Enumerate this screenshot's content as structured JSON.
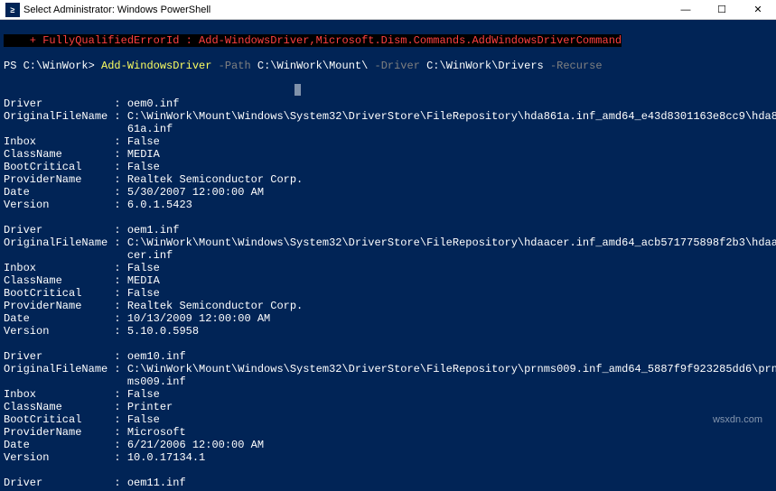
{
  "window": {
    "icon_text": "≥",
    "title": "Select Administrator: Windows PowerShell",
    "minimize": "—",
    "maximize": "☐",
    "close": "✕"
  },
  "error": {
    "line": "    + FullyQualifiedErrorId : Add-WindowsDriver,Microsoft.Dism.Commands.AddWindowsDriverCommand"
  },
  "command": {
    "prompt": "PS C:\\WinWork> ",
    "cmdlet": "Add-WindowsDriver ",
    "param1": "-Path ",
    "val1": "C:\\WinWork\\Mount\\ ",
    "param2": "-Driver ",
    "val2": "C:\\WinWork\\Drivers ",
    "param3": "-Recurse"
  },
  "drivers": [
    {
      "Driver": "oem0.inf",
      "OriginalFileName": "C:\\WinWork\\Mount\\Windows\\System32\\DriverStore\\FileRepository\\hda861a.inf_amd64_e43d8301163e8cc9\\hda8",
      "OriginalFileName2": "61a.inf",
      "Inbox": "False",
      "ClassName": "MEDIA",
      "BootCritical": "False",
      "ProviderName": "Realtek Semiconductor Corp.",
      "Date": "5/30/2007 12:00:00 AM",
      "Version": "6.0.1.5423"
    },
    {
      "Driver": "oem1.inf",
      "OriginalFileName": "C:\\WinWork\\Mount\\Windows\\System32\\DriverStore\\FileRepository\\hdaacer.inf_amd64_acb571775898f2b3\\hdaa",
      "OriginalFileName2": "cer.inf",
      "Inbox": "False",
      "ClassName": "MEDIA",
      "BootCritical": "False",
      "ProviderName": "Realtek Semiconductor Corp.",
      "Date": "10/13/2009 12:00:00 AM",
      "Version": "5.10.0.5958"
    },
    {
      "Driver": "oem10.inf",
      "OriginalFileName": "C:\\WinWork\\Mount\\Windows\\System32\\DriverStore\\FileRepository\\prnms009.inf_amd64_5887f9f923285dd6\\prn",
      "OriginalFileName2": "ms009.inf",
      "Inbox": "False",
      "ClassName": "Printer",
      "BootCritical": "False",
      "ProviderName": "Microsoft",
      "Date": "6/21/2006 12:00:00 AM",
      "Version": "10.0.17134.1"
    }
  ],
  "partial": {
    "Driver": "oem11.inf"
  },
  "labels": {
    "Driver": "Driver           : ",
    "OriginalFileName": "OriginalFileName : ",
    "Cont": "                   ",
    "Inbox": "Inbox            : ",
    "ClassName": "ClassName        : ",
    "BootCritical": "BootCritical     : ",
    "ProviderName": "ProviderName     : ",
    "Date": "Date             : ",
    "Version": "Version          : "
  },
  "watermark": "wsxdn.com"
}
